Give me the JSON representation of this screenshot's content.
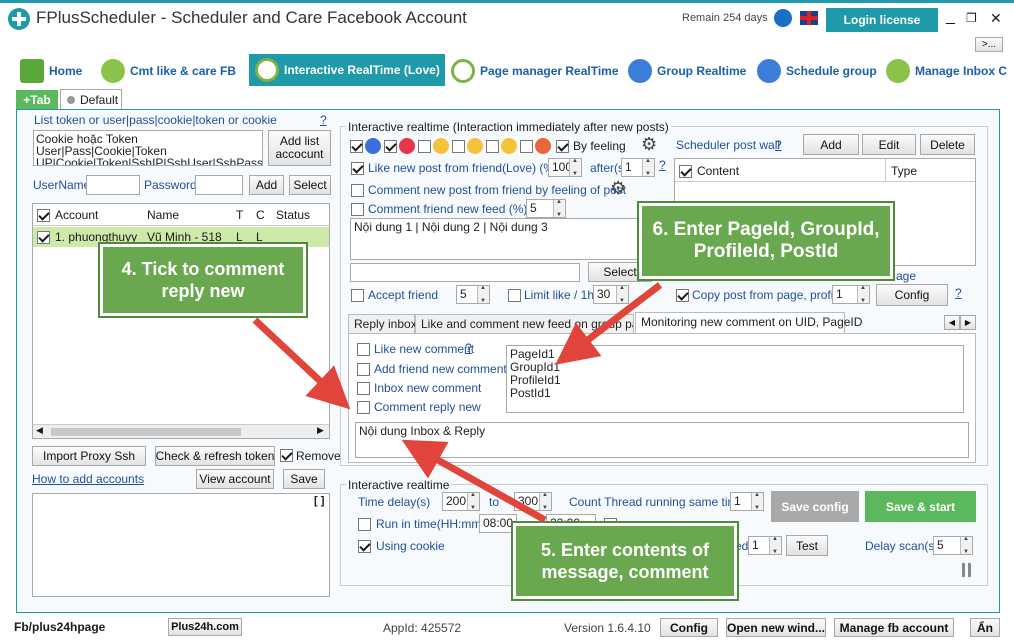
{
  "titlebar": {
    "title": "FPlusScheduler - Scheduler and Care Facebook Account",
    "remain": "Remain 254 days",
    "login_label": "Login license",
    "minimize": "_",
    "restore": "❐",
    "close": "✕",
    "more": ">..."
  },
  "nav": {
    "items": [
      "Home",
      "Cmt like & care FB",
      "Interactive RealTime (Love)",
      "Page manager RealTime",
      "Group Realtime",
      "Schedule group",
      "Manage Inbox C"
    ]
  },
  "tabs": {
    "add": "+Tab",
    "default": "Default"
  },
  "left": {
    "token_label": "List token or user|pass|cookie|token or cookie",
    "help": "?",
    "token_text": [
      "Cookie hoặc Token",
      "User|Pass|Cookie|Token",
      "UP|Cookie|Token|SshIP|SshUser|SshPass"
    ],
    "add_list_account": "Add list accocunt",
    "username_label": "UserName",
    "password_label": "Password",
    "add": "Add",
    "select": "Select",
    "columns": [
      "Account",
      "Name",
      "T",
      "C",
      "Status"
    ],
    "row": {
      "account": "1. phuongthuyy",
      "name": "Vũ Minh - 518",
      "t": "L",
      "c": "L",
      "status": ""
    },
    "import_proxy": "Import Proxy Ssh",
    "check_refresh": "Check & refresh token",
    "remove": "Remove",
    "how_to_add": "How to add accounts",
    "view_account": "View account",
    "save": "Save",
    "brackets": "[ ]"
  },
  "interactive": {
    "group_title": "Interactive realtime (Interaction immediately after new posts)",
    "by_feeling": "By feeling",
    "like_new_post": "Like new post from friend(Love) (%)",
    "like_value": "100",
    "after_label": "after(s",
    "after_value": "1",
    "help": "?",
    "comment_by_feeling": "Comment new post from friend by feeling of post",
    "comment_feed": "Comment friend new feed (%)",
    "comment_feed_value": "5",
    "content_text": "Nội dung 1 | Nội dung 2 | Nội dung 3",
    "select": "Select",
    "accept_friend": "Accept friend",
    "accept_value": "5",
    "limit_like": "Limit like / 1h",
    "limit_value": "30",
    "scheduler_title": "Scheduler post wall",
    "add": "Add",
    "edit": "Edit",
    "delete": "Delete",
    "sched_cols": [
      "Content",
      "Type"
    ],
    "page_frag": "age",
    "copy_post": "Copy post from page, profile,",
    "copy_value": "1",
    "config": "Config"
  },
  "subtabs": [
    "Reply inbox",
    "Like and comment new feed on group page",
    "Monitoring new comment on UID, PageID"
  ],
  "monitor": {
    "like_new_comment": "Like new comment",
    "add_friend": "Add friend new comment",
    "inbox_new": "Inbox new comment",
    "comment_reply": "Comment reply new",
    "ids": [
      "PageId1",
      "GroupId1",
      "ProfileId1",
      "PostId1"
    ],
    "message": "Nội dung Inbox & Reply"
  },
  "realtime": {
    "group_title": "Interactive realtime",
    "time_delay": "Time delay(s)",
    "delay_from": "200",
    "to": "to",
    "delay_to": "300",
    "count_thread": "Count Thread running same time",
    "thread_value": "1",
    "save_config": "Save config",
    "save_start": "Save & start",
    "run_in_time": "Run in time(HH:mm)",
    "time_from": "08:00",
    "time_to": "22:00",
    "using_cookie": "Using cookie",
    "ed_frag": "ed",
    "ed_value": "1",
    "test": "Test",
    "delay_scan": "Delay scan(s)",
    "scan_value": "5"
  },
  "callouts": {
    "c4": "4. Tick to comment reply new",
    "c5": "5. Enter contents of message, comment",
    "c6": "6. Enter PageId, GroupId, ProfileId, PostId"
  },
  "footer": {
    "fb": "Fb/plus24hpage",
    "site": "Plus24h.com",
    "appid": "AppId: 425572",
    "version": "Version 1.6.4.10",
    "config": "Config",
    "open_new": "Open new wind...",
    "manage": "Manage fb account",
    "hide": "Ẩn"
  },
  "colors": {
    "accent": "#1e9aa8",
    "green": "#5cb85c",
    "callout": "#6aa84f",
    "arrow": "#e0443a"
  }
}
